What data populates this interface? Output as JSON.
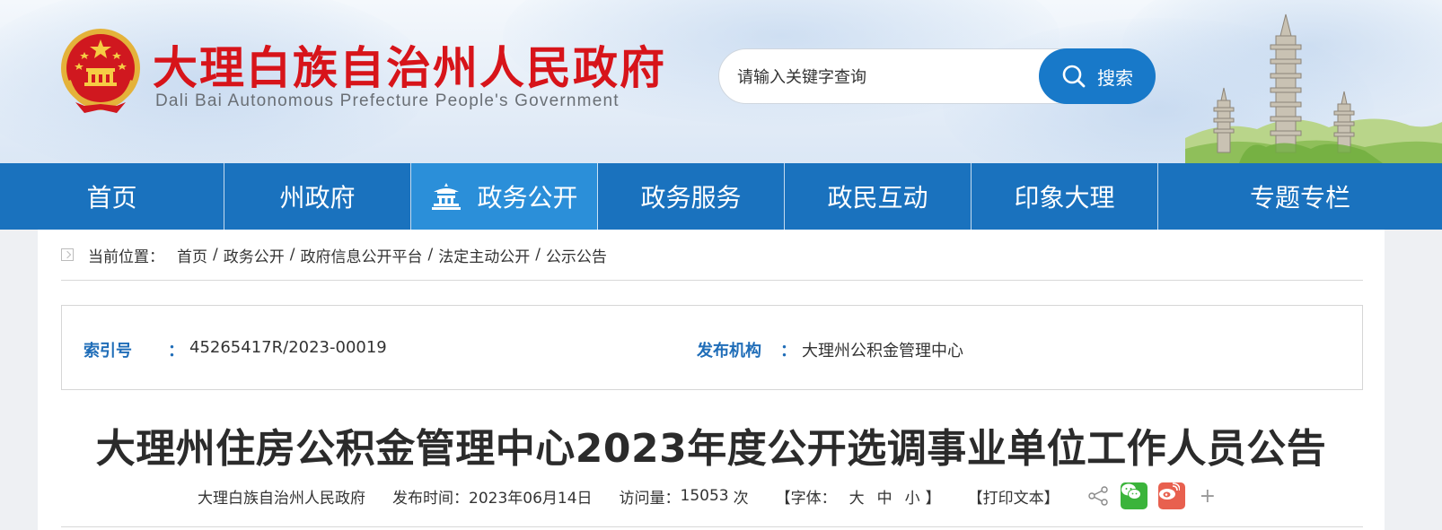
{
  "header": {
    "site_title": "大理白族自治州人民政府",
    "site_subtitle": "Dali Bai Autonomous Prefecture People's Government",
    "search": {
      "placeholder": "请输入关键字查询",
      "button_label": "搜索"
    }
  },
  "nav": {
    "items": [
      {
        "label": "首页",
        "active": false
      },
      {
        "label": "州政府",
        "active": false
      },
      {
        "label": "政务公开",
        "active": true,
        "icon": "temple-icon"
      },
      {
        "label": "政务服务",
        "active": false
      },
      {
        "label": "政民互动",
        "active": false
      },
      {
        "label": "印象大理",
        "active": false
      },
      {
        "label": "专题专栏",
        "active": false
      }
    ]
  },
  "breadcrumb": {
    "label": "当前位置：",
    "items": [
      "首页",
      "政务公开",
      "政府信息公开平台",
      "法定主动公开",
      "公示公告"
    ],
    "separator": "/"
  },
  "info": {
    "index_label": "索引号",
    "index_value": "45265417R/2023-00019",
    "publisher_label": "发布机构",
    "publisher_value": "大理州公积金管理中心",
    "colon": "："
  },
  "article": {
    "title": "大理州住房公积金管理中心2023年度公开选调事业单位工作人员公告",
    "source": "大理白族自治州人民政府",
    "publish_label": "发布时间：",
    "publish_date": "2023年06月14日",
    "visits_label": "访问量：",
    "visits_count": "15053",
    "visits_unit": "次",
    "font_size_label": "【字体：",
    "font_size_options": [
      "大",
      "中",
      "小"
    ],
    "font_size_close": "】",
    "print_label": "【打印文本】",
    "share_more": "+"
  },
  "colors": {
    "nav_bg": "#1a72be",
    "nav_active": "#2b8fd9",
    "title_red": "#d7141a",
    "label_blue": "#1f6db8"
  }
}
